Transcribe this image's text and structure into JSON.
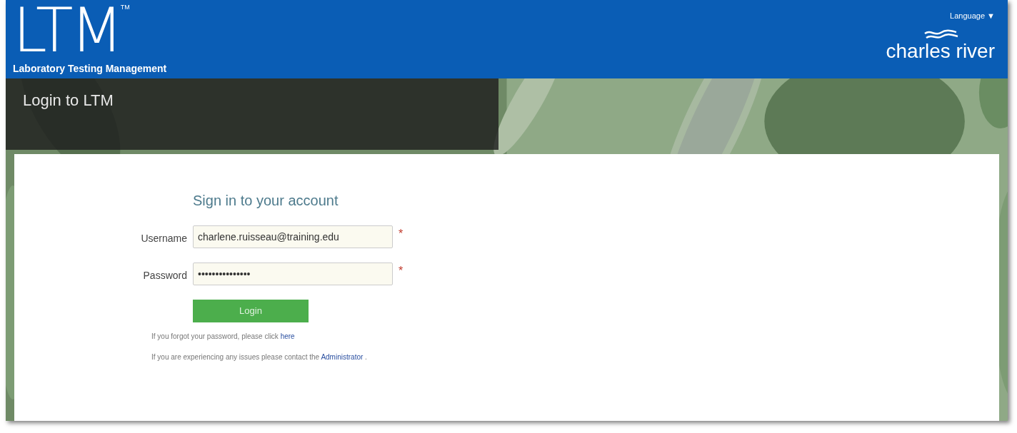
{
  "header": {
    "logo": "LTM",
    "trademark": "TM",
    "tagline": "Laboratory Testing Management",
    "language_menu": "Language ▼",
    "brand": "charles river"
  },
  "banner": {
    "title": "Login to LTM",
    "kind": "picture"
  },
  "form": {
    "heading": "Sign in to your account",
    "fields": [
      {
        "label": "Username",
        "value": "charlene.ruisseau@training.edu",
        "required_mark": "*"
      },
      {
        "label": "Password",
        "value": "•••••••••••••••",
        "required_mark": "*"
      }
    ],
    "submit": "Login",
    "forgot_text": "If you forgot your password, please click",
    "forgot_link": "here",
    "contact_text": "If you are experiencing any issues please contact the",
    "contact_link": "Administrator",
    "contact_end": "."
  }
}
